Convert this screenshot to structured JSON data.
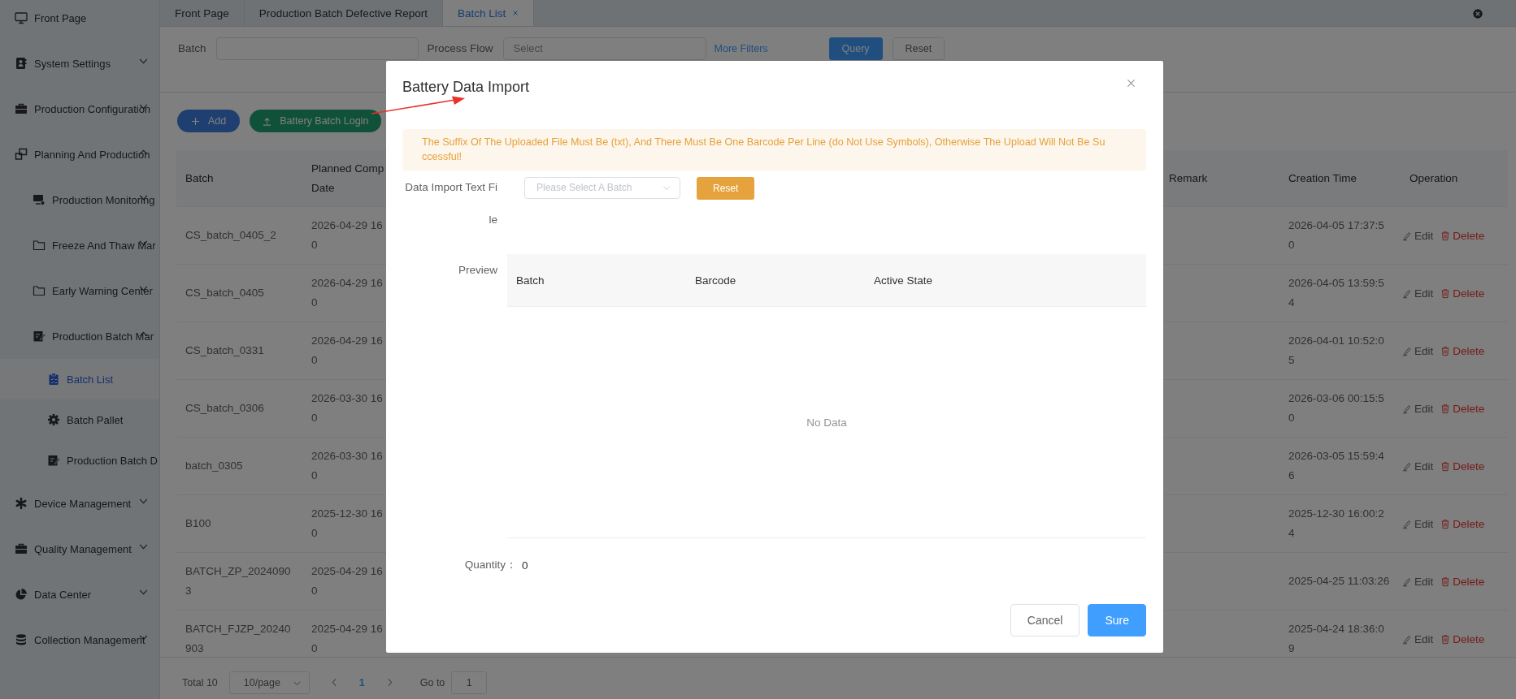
{
  "sidebar": {
    "items": [
      {
        "label": "Front Page",
        "selected": false
      },
      {
        "label": "System Settings",
        "selected": false,
        "expanded": false
      },
      {
        "label": "Production Configuration",
        "selected": false,
        "expanded": false
      },
      {
        "label": "Planning And Production",
        "selected": false,
        "expanded": true,
        "children": [
          {
            "label": "Production Monitoring",
            "selected": false,
            "expanded": false
          },
          {
            "label": "Freeze And Thaw Mar",
            "selected": false,
            "expanded": false
          },
          {
            "label": "Early Warning Center",
            "selected": false,
            "expanded": false
          },
          {
            "label": "Production Batch Mar",
            "selected": false,
            "expanded": true,
            "children": [
              {
                "label": "Batch List",
                "selected": true
              },
              {
                "label": "Batch Pallet",
                "selected": false
              },
              {
                "label": "Production Batch D",
                "selected": false
              }
            ]
          }
        ]
      },
      {
        "label": "Device Management",
        "selected": false,
        "expanded": false
      },
      {
        "label": "Quality Management",
        "selected": false,
        "expanded": false
      },
      {
        "label": "Data Center",
        "selected": false,
        "expanded": false
      },
      {
        "label": "Collection Management",
        "selected": false,
        "expanded": false
      }
    ]
  },
  "tabs": [
    {
      "label": "Front Page",
      "selected": false,
      "closable": false
    },
    {
      "label": "Production Batch Defective Report",
      "selected": false,
      "closable": false
    },
    {
      "label": "Batch List",
      "selected": true,
      "closable": true
    }
  ],
  "filters": {
    "batch_label": "Batch",
    "process_flow_label": "Process Flow",
    "process_flow_placeholder": "Select",
    "more_filters": "More Filters",
    "query": "Query",
    "reset": "Reset"
  },
  "toolbar": {
    "add": "Add",
    "batch_login": "Battery Batch Login"
  },
  "table": {
    "columns": [
      "Batch",
      "Planned Comp\nDate",
      "Remark",
      "Creation Time",
      "Operation"
    ],
    "rows": [
      {
        "batch": "CS_batch_0405_2",
        "planned": "2026-04-29 16\n0",
        "created": "2026-04-05 17:37:5\n0",
        "edit": "Edit",
        "delete": "Delete"
      },
      {
        "batch": "CS_batch_0405",
        "planned": "2026-04-29 16\n0",
        "created": "2026-04-05 13:59:5\n4",
        "edit": "Edit",
        "delete": "Delete"
      },
      {
        "batch": "CS_batch_0331",
        "planned": "2026-04-29 16\n0",
        "created": "2026-04-01 10:52:0\n5",
        "edit": "Edit",
        "delete": "Delete"
      },
      {
        "batch": "CS_batch_0306",
        "planned": "2026-03-30 16\n0",
        "created": "2026-03-06 00:15:5\n0",
        "edit": "Edit",
        "delete": "Delete"
      },
      {
        "batch": "batch_0305",
        "planned": "2026-03-30 16\n0",
        "created": "2026-03-05 15:59:4\n6",
        "edit": "Edit",
        "delete": "Delete"
      },
      {
        "batch": "B100",
        "planned": "2025-12-30 16\n0",
        "created": "2025-12-30 16:00:2\n4",
        "edit": "Edit",
        "delete": "Delete"
      },
      {
        "batch": "BATCH_ZP_2024090\n3",
        "planned": "2025-04-29 16\n0",
        "created": "2025-04-25 11:03:26",
        "edit": "Edit",
        "delete": "Delete"
      },
      {
        "batch": "BATCH_FJZP_20240\n903",
        "planned": "2025-04-29 16\n0",
        "created": "2025-04-24 18:36:0\n9",
        "edit": "Edit",
        "delete": "Delete"
      }
    ]
  },
  "pagination": {
    "total": "Total 10",
    "page_size": "10/page",
    "pages": [
      {
        "label": "1",
        "selected": true
      }
    ],
    "goto_label": "Go to",
    "goto_value": "1"
  },
  "modal": {
    "title": "Battery Data Import",
    "alert": "The Suffix Of The Uploaded File Must Be (txt), And There Must Be One Barcode Per Line (do Not Use Symbols), Otherwise The Upload Will Not Be Su\nccessful!",
    "file_label": "Data Import Text Fi\nle",
    "batch_placeholder": "Please Select A Batch",
    "reset": "Reset",
    "preview_label": "Preview",
    "preview_columns": [
      "Batch",
      "Barcode",
      "Active State"
    ],
    "empty_text": "No Data",
    "quantity_label": "Quantity：",
    "quantity": "0",
    "cancel": "Cancel",
    "sure": "Sure"
  }
}
